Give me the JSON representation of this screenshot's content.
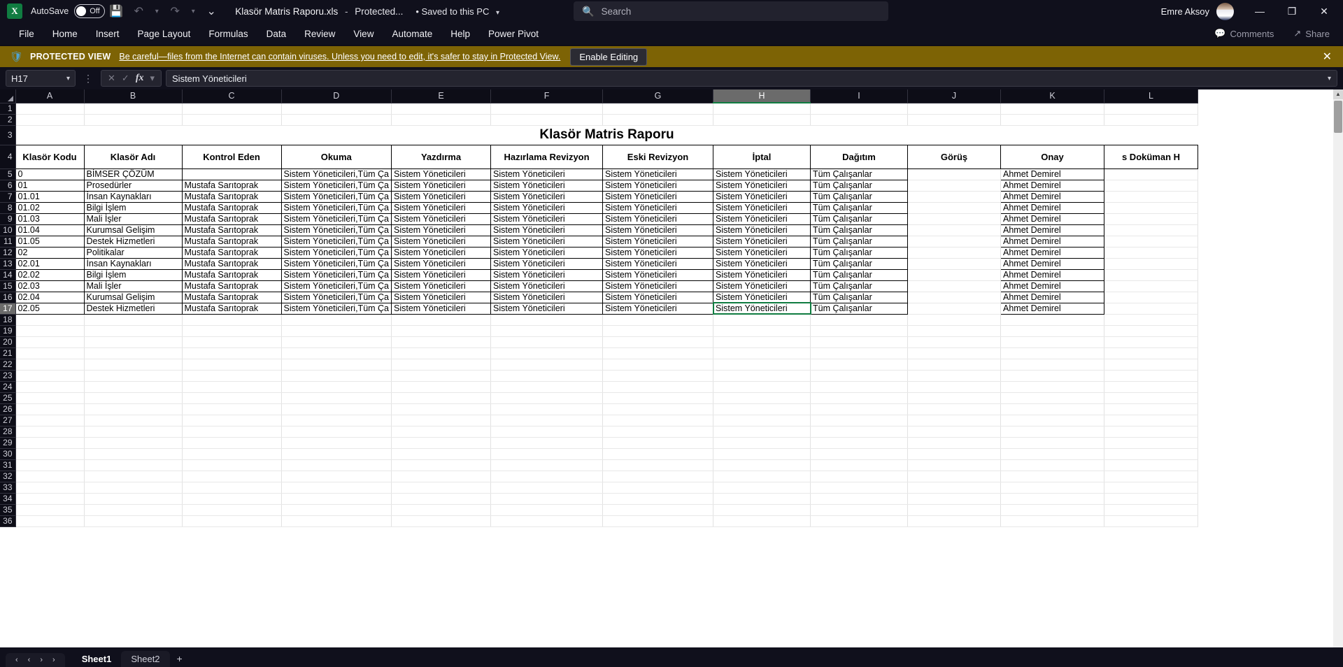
{
  "titlebar": {
    "logo_text": "X",
    "autosave_label": "AutoSave",
    "autosave_state": "Off",
    "save_icon": "save-icon",
    "undo_icon": "undo-icon",
    "redo_icon": "redo-icon",
    "customize_icon": "customize-quick-access-icon",
    "doc_name": "Klasör Matris Raporu.xls",
    "doc_sep": "-",
    "doc_status": "Protected...",
    "saved_location": "• Saved to this PC",
    "search_placeholder": "Search",
    "user_name": "Emre Aksoy",
    "minimize": "—",
    "restore": "❐",
    "close": "✕"
  },
  "ribbon": {
    "tabs": [
      "File",
      "Home",
      "Insert",
      "Page Layout",
      "Formulas",
      "Data",
      "Review",
      "View",
      "Automate",
      "Help",
      "Power Pivot"
    ],
    "comments_label": "Comments",
    "share_label": "Share"
  },
  "protected_view": {
    "title": "PROTECTED VIEW",
    "message": "Be careful—files from the Internet can contain viruses. Unless you need to edit, it's safer to stay in Protected View.",
    "button": "Enable Editing",
    "close": "✕",
    "bg_color": "#7d6305"
  },
  "formula_bar": {
    "name_box": "H17",
    "cancel": "✕",
    "confirm": "✓",
    "fx": "fx",
    "value": "Sistem Yöneticileri"
  },
  "grid": {
    "columns": [
      "A",
      "B",
      "C",
      "D",
      "E",
      "F",
      "G",
      "H",
      "I",
      "J",
      "K",
      "L"
    ],
    "selected_column": "H",
    "selected_row": "17",
    "selected_cell": "H17",
    "row_numbers": [
      "1",
      "2",
      "3",
      "4",
      "5",
      "6",
      "7",
      "8",
      "9",
      "10",
      "11",
      "12",
      "13",
      "14",
      "15",
      "16",
      "17",
      "18",
      "19",
      "20",
      "21",
      "22",
      "23",
      "24",
      "25",
      "26",
      "27",
      "28",
      "29",
      "30",
      "31",
      "32",
      "33",
      "34",
      "35",
      "36"
    ],
    "report_title": "Klasör Matris Raporu",
    "headers": [
      "Klasör Kodu",
      "Klasör Adı",
      "Kontrol Eden",
      "Okuma",
      "Yazdırma",
      "Hazırlama Revizyon",
      "Eski Revizyon",
      "İptal",
      "Dağıtım",
      "Görüş",
      "Onay",
      "s Doküman H"
    ],
    "rows": [
      [
        "0",
        "BİMSER ÇÖZÜM",
        "",
        "Sistem Yöneticileri,Tüm Ça",
        "Sistem Yöneticileri",
        "Sistem Yöneticileri",
        "Sistem Yöneticileri",
        "Sistem Yöneticileri",
        "Tüm Çalışanlar",
        "",
        "Ahmet Demirel",
        ""
      ],
      [
        "01",
        "Prosedürler",
        "Mustafa Sarıtoprak",
        "Sistem Yöneticileri,Tüm Ça",
        "Sistem Yöneticileri",
        "Sistem Yöneticileri",
        "Sistem Yöneticileri",
        "Sistem Yöneticileri",
        "Tüm Çalışanlar",
        "",
        "Ahmet Demirel",
        ""
      ],
      [
        "01.01",
        "İnsan Kaynakları",
        "Mustafa Sarıtoprak",
        "Sistem Yöneticileri,Tüm Ça",
        "Sistem Yöneticileri",
        "Sistem Yöneticileri",
        "Sistem Yöneticileri",
        "Sistem Yöneticileri",
        "Tüm Çalışanlar",
        "",
        "Ahmet Demirel",
        ""
      ],
      [
        "01.02",
        "Bilgi İşlem",
        "Mustafa Sarıtoprak",
        "Sistem Yöneticileri,Tüm Ça",
        "Sistem Yöneticileri",
        "Sistem Yöneticileri",
        "Sistem Yöneticileri",
        "Sistem Yöneticileri",
        "Tüm Çalışanlar",
        "",
        "Ahmet Demirel",
        ""
      ],
      [
        "01.03",
        "Mali İşler",
        "Mustafa Sarıtoprak",
        "Sistem Yöneticileri,Tüm Ça",
        "Sistem Yöneticileri",
        "Sistem Yöneticileri",
        "Sistem Yöneticileri",
        "Sistem Yöneticileri",
        "Tüm Çalışanlar",
        "",
        "Ahmet Demirel",
        ""
      ],
      [
        "01.04",
        "Kurumsal Gelişim",
        "Mustafa Sarıtoprak",
        "Sistem Yöneticileri,Tüm Ça",
        "Sistem Yöneticileri",
        "Sistem Yöneticileri",
        "Sistem Yöneticileri",
        "Sistem Yöneticileri",
        "Tüm Çalışanlar",
        "",
        "Ahmet Demirel",
        ""
      ],
      [
        "01.05",
        "Destek Hizmetleri",
        "Mustafa Sarıtoprak",
        "Sistem Yöneticileri,Tüm Ça",
        "Sistem Yöneticileri",
        "Sistem Yöneticileri",
        "Sistem Yöneticileri",
        "Sistem Yöneticileri",
        "Tüm Çalışanlar",
        "",
        "Ahmet Demirel",
        ""
      ],
      [
        "02",
        "Politikalar",
        "Mustafa Sarıtoprak",
        "Sistem Yöneticileri,Tüm Ça",
        "Sistem Yöneticileri",
        "Sistem Yöneticileri",
        "Sistem Yöneticileri",
        "Sistem Yöneticileri",
        "Tüm Çalışanlar",
        "",
        "Ahmet Demirel",
        ""
      ],
      [
        "02.01",
        "İnsan Kaynakları",
        "Mustafa Sarıtoprak",
        "Sistem Yöneticileri,Tüm Ça",
        "Sistem Yöneticileri",
        "Sistem Yöneticileri",
        "Sistem Yöneticileri",
        "Sistem Yöneticileri",
        "Tüm Çalışanlar",
        "",
        "Ahmet Demirel",
        ""
      ],
      [
        "02.02",
        "Bilgi İşlem",
        "Mustafa Sarıtoprak",
        "Sistem Yöneticileri,Tüm Ça",
        "Sistem Yöneticileri",
        "Sistem Yöneticileri",
        "Sistem Yöneticileri",
        "Sistem Yöneticileri",
        "Tüm Çalışanlar",
        "",
        "Ahmet Demirel",
        ""
      ],
      [
        "02.03",
        "Mali İşler",
        "Mustafa Sarıtoprak",
        "Sistem Yöneticileri,Tüm Ça",
        "Sistem Yöneticileri",
        "Sistem Yöneticileri",
        "Sistem Yöneticileri",
        "Sistem Yöneticileri",
        "Tüm Çalışanlar",
        "",
        "Ahmet Demirel",
        ""
      ],
      [
        "02.04",
        "Kurumsal Gelişim",
        "Mustafa Sarıtoprak",
        "Sistem Yöneticileri,Tüm Ça",
        "Sistem Yöneticileri",
        "Sistem Yöneticileri",
        "Sistem Yöneticileri",
        "Sistem Yöneticileri",
        "Tüm Çalışanlar",
        "",
        "Ahmet Demirel",
        ""
      ],
      [
        "02.05",
        "Destek Hizmetleri",
        "Mustafa Sarıtoprak",
        "Sistem Yöneticileri,Tüm Ça",
        "Sistem Yöneticileri",
        "Sistem Yöneticileri",
        "Sistem Yöneticileri",
        "Sistem Yöneticileri",
        "Tüm Çalışanlar",
        "",
        "Ahmet Demirel",
        ""
      ]
    ]
  },
  "sheetbar": {
    "nav_first": "‹",
    "nav_prev": "‹",
    "nav_next": "›",
    "nav_last": "›",
    "tabs": [
      "Sheet1",
      "Sheet2"
    ],
    "active_tab": "Sheet1",
    "add_sheet": "+"
  }
}
